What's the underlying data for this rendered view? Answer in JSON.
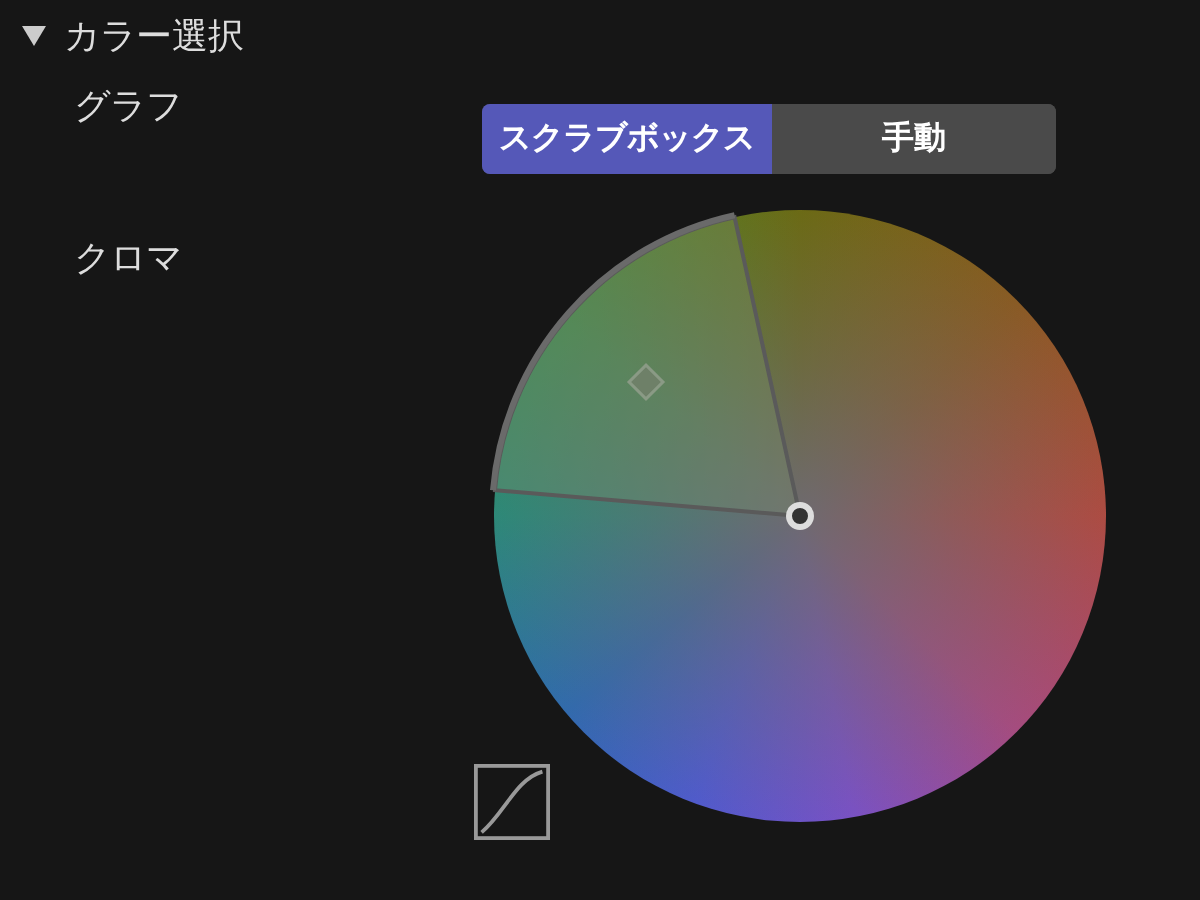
{
  "section": {
    "title": "カラー選択",
    "expanded": true
  },
  "graph": {
    "label": "グラフ",
    "segments": [
      {
        "label": "スクラブボックス",
        "selected": true
      },
      {
        "label": "手動",
        "selected": false
      }
    ]
  },
  "chroma": {
    "label": "クロマ"
  }
}
